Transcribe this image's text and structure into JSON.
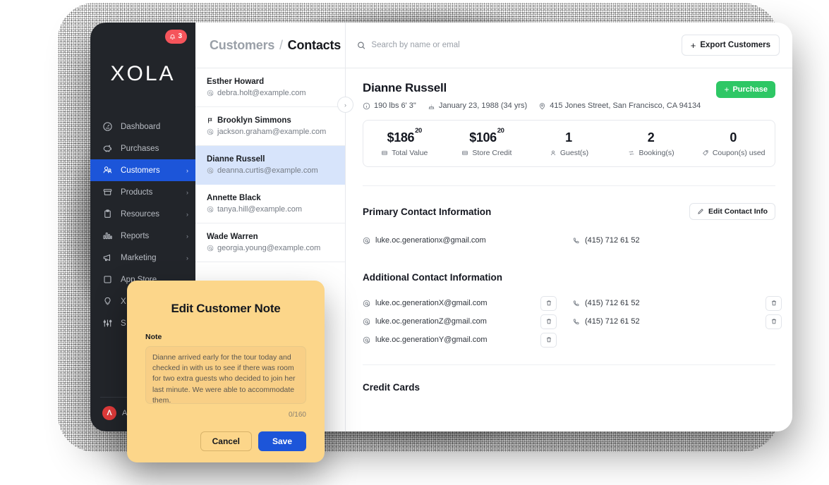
{
  "sidebar": {
    "notification_badge": {
      "icon": "bell-icon",
      "count": "3"
    },
    "logo": "XOLA",
    "items": [
      {
        "label": "Dashboard",
        "icon": "dashboard-icon",
        "chevron": "",
        "active": false
      },
      {
        "label": "Purchases",
        "icon": "piggy-bank-icon",
        "chevron": "",
        "active": false
      },
      {
        "label": "Customers",
        "icon": "users-icon",
        "chevron": "›",
        "active": true
      },
      {
        "label": "Products",
        "icon": "box-icon",
        "chevron": "›",
        "active": false
      },
      {
        "label": "Resources",
        "icon": "clipboard-icon",
        "chevron": "›",
        "active": false
      },
      {
        "label": "Reports",
        "icon": "bar-chart-icon",
        "chevron": "›",
        "active": false
      },
      {
        "label": "Marketing",
        "icon": "megaphone-icon",
        "chevron": "›",
        "active": false
      },
      {
        "label": "App Store",
        "icon": "square-icon",
        "chevron": "",
        "active": false
      },
      {
        "label": "X",
        "icon": "lightbulb-icon",
        "chevron": "",
        "active": false
      },
      {
        "label": "S",
        "icon": "sliders-icon",
        "chevron": "",
        "active": false
      }
    ],
    "user": {
      "avatar_initial": "Λ",
      "name": "A"
    }
  },
  "breadcrumb": {
    "parent": "Customers",
    "separator": "/",
    "current": "Contacts"
  },
  "search": {
    "placeholder": "Search by name or emal",
    "value": "",
    "icon": "search-icon"
  },
  "export_button": {
    "plus": "+",
    "label": "Export Customers"
  },
  "contact_list": {
    "toggle_icon": "›",
    "contacts": [
      {
        "name": "Esther Howard",
        "email": "debra.holt@example.com",
        "flagged": false,
        "selected": false
      },
      {
        "name": "Brooklyn Simmons",
        "email": "jackson.graham@example.com",
        "flagged": true,
        "selected": false
      },
      {
        "name": "Dianne Russell",
        "email": "deanna.curtis@example.com",
        "flagged": false,
        "selected": true
      },
      {
        "name": "Annette Black",
        "email": "tanya.hill@example.com",
        "flagged": false,
        "selected": false
      },
      {
        "name": "Wade Warren",
        "email": "georgia.young@example.com",
        "flagged": false,
        "selected": false
      }
    ]
  },
  "customer": {
    "name": "Dianne Russell",
    "meta": [
      {
        "icon": "info-icon",
        "text": "190 lbs 6' 3\""
      },
      {
        "icon": "calendar-icon",
        "text": "January 23, 1988 (34 yrs)"
      },
      {
        "icon": "pin-icon",
        "text": "415 Jones Street, San Francisco, CA 94134"
      }
    ],
    "purchase_button": {
      "plus": "+",
      "label": "Purchase"
    },
    "stats": [
      {
        "value": "$186",
        "sup": "20",
        "label": "Total Value",
        "icon": "card-icon"
      },
      {
        "value": "$106",
        "sup": "20",
        "label": "Store Credit",
        "icon": "card-icon"
      },
      {
        "value": "1",
        "sup": "",
        "label": "Guest(s)",
        "icon": "person-icon"
      },
      {
        "value": "2",
        "sup": "",
        "label": "Booking(s)",
        "icon": "booking-icon"
      },
      {
        "value": "0",
        "sup": "",
        "label": "Coupon(s) used",
        "icon": "tag-icon"
      }
    ]
  },
  "primary_contact": {
    "title": "Primary Contact Information",
    "edit_button": {
      "icon": "pencil-icon",
      "label": "Edit Contact Info"
    },
    "email": "luke.oc.generationx@gmail.com",
    "phone": "(415) 712 61 52"
  },
  "additional_contact": {
    "title": "Additional Contact Information",
    "rows": [
      {
        "email": "luke.oc.generationX@gmail.com",
        "phone": "(415) 712 61 52"
      },
      {
        "email": "luke.oc.generationZ@gmail.com",
        "phone": "(415) 712 61 52"
      },
      {
        "email": "luke.oc.generationY@gmail.com",
        "phone": ""
      }
    ],
    "delete_icon": "trash-icon"
  },
  "credit_cards": {
    "title": "Credit Cards"
  },
  "modal": {
    "title": "Edit Customer Note",
    "field_label": "Note",
    "note_value": "Dianne arrived early for the tour today and checked in with us to see if there was room for two extra guests who decided to join her last minute. We were able to accommodate them.",
    "counter": "0/160",
    "cancel_label": "Cancel",
    "save_label": "Save"
  },
  "colors": {
    "sidebar_bg": "#22252a",
    "accent_blue": "#1c55d9",
    "green": "#2ec765",
    "badge_red": "#f5545b",
    "modal_yellow": "#fcd68a",
    "selected_row": "#d7e4fb"
  }
}
